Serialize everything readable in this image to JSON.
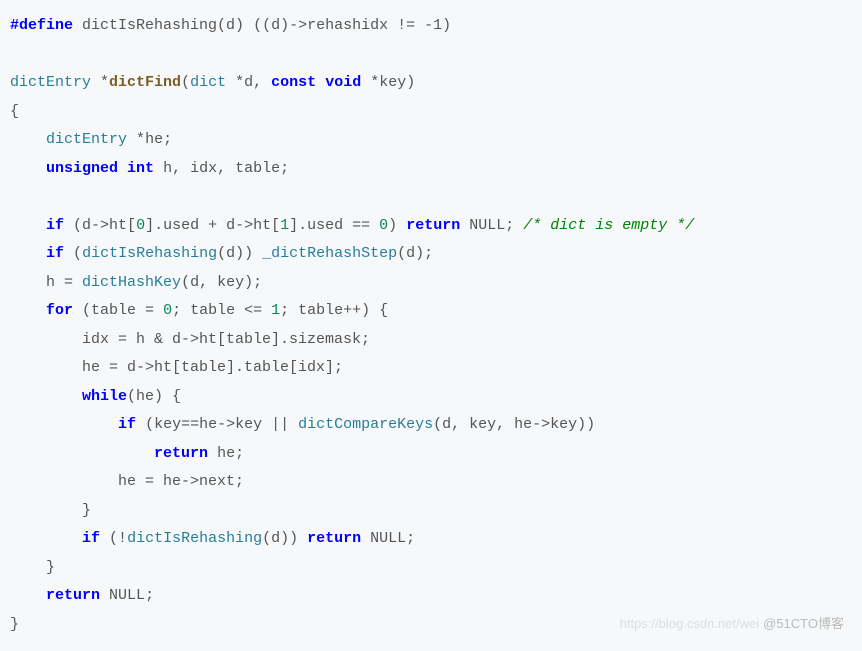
{
  "code": {
    "line1": {
      "define": "#define",
      "macro": "dictIsRehashing(d)",
      "body": "((d)->rehashidx != -1)"
    },
    "line3": {
      "ret_type": "dictEntry",
      "star": "*",
      "fname": "dictFind",
      "p1t": "dict",
      "p1n": "d",
      "const": "const",
      "void": "void",
      "p2n": "key"
    },
    "line4": "{",
    "line5": {
      "type": "dictEntry",
      "star": "*",
      "var": "he;"
    },
    "line6": {
      "uint": "unsigned int",
      "vars": "h, idx, table;"
    },
    "line8": {
      "if": "if",
      "expr": "(d->ht[",
      "n0": "0",
      "mid1": "].used + d->ht[",
      "n1": "1",
      "mid2": "].used == ",
      "n0b": "0",
      "close": ")",
      "ret": "return",
      "null": "NULL",
      "semi": ";",
      "comment": "/* dict is empty */"
    },
    "line9": {
      "if": "if",
      "open": "(",
      "call1": "dictIsRehashing",
      "arg1": "(d))",
      "call2": "_dictRehashStep",
      "arg2": "(d);"
    },
    "line10": {
      "h": "h = ",
      "call": "dictHashKey",
      "args": "(d, key);"
    },
    "line11": {
      "for": "for",
      "open": "(table = ",
      "n0": "0",
      "mid": "; table <= ",
      "n1": "1",
      "end": "; table++) {"
    },
    "line12": "idx = h & d->ht[table].sizemask;",
    "line13": "he = d->ht[table].table[idx];",
    "line14": {
      "while": "while",
      "cond": "(he) {"
    },
    "line15": {
      "if": "if",
      "open": "(key==he->key || ",
      "call": "dictCompareKeys",
      "args": "(d, key, he->key))"
    },
    "line16": {
      "ret": "return",
      "he": "he;"
    },
    "line17": "he = he->next;",
    "line18": "}",
    "line19": {
      "if": "if",
      "open": "(!",
      "call": "dictIsRehashing",
      "args": "(d))",
      "ret": "return",
      "null": "NULL",
      "semi": ";"
    },
    "line20": "}",
    "line21": {
      "ret": "return",
      "null": "NULL",
      "semi": ";"
    },
    "line22": "}"
  },
  "watermark": {
    "faint": "https://blog.csdn.net/wei",
    "text": "@51CTO博客"
  }
}
